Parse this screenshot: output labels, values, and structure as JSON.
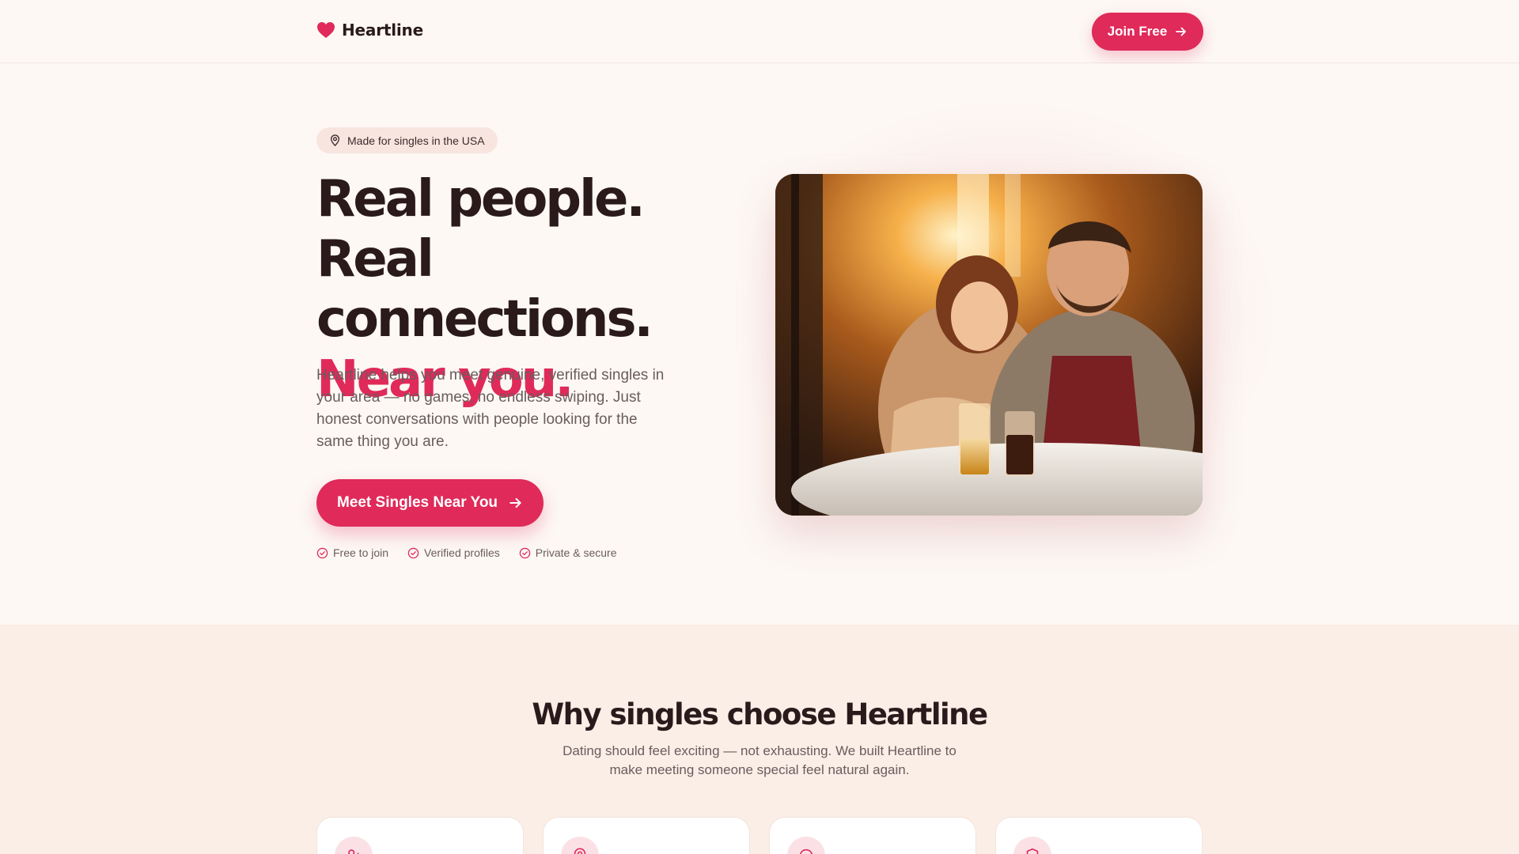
{
  "header": {
    "brand_name": "Heartline",
    "join_label": "Join Free"
  },
  "hero": {
    "badge": "Made for singles in the USA",
    "title_line1": "Real people. Real connections.",
    "title_accent": "Near you.",
    "description": "Heartline helps you meet genuine, verified singles in your area — no games, no endless swiping. Just honest conversations with people looking for the same thing you are.",
    "cta_label": "Meet Singles Near You",
    "trust_items": [
      "Free to join",
      "Verified profiles",
      "Private & secure"
    ],
    "photo_icon": "couple-photo"
  },
  "why": {
    "title": "Why singles choose Heartline",
    "subtitle": "Dating should feel exciting — not exhausting. We built Heartline to make meeting someone special feel natural again.",
    "cards": [
      {
        "icon": "user-plus-icon"
      },
      {
        "icon": "map-pin-icon"
      },
      {
        "icon": "chat-bubble-icon"
      },
      {
        "icon": "shield-icon"
      }
    ]
  },
  "colors": {
    "accent": "#df2a5a",
    "background": "#fdf8f4",
    "section_bg": "#fbeee6",
    "text": "#2a1a1c",
    "muted": "#6a5c5e"
  }
}
